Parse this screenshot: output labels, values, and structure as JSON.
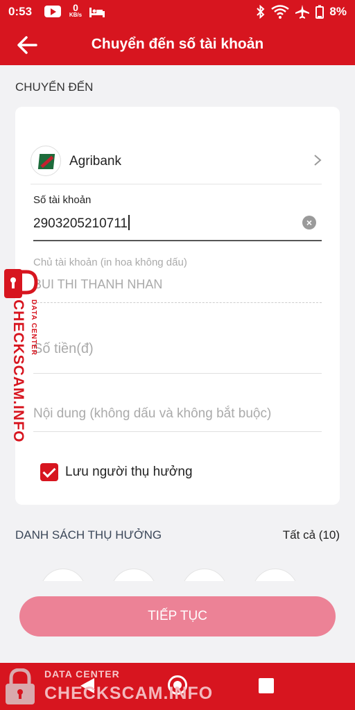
{
  "status_bar": {
    "time": "0:53",
    "net_speed": "0",
    "net_unit": "KB/s",
    "battery": "8%"
  },
  "app_bar": {
    "back_icon": "arrow-left-icon",
    "title": "Chuyển đến số tài khoản"
  },
  "transfer_section": {
    "title": "CHUYỂN ĐẾN"
  },
  "form": {
    "bank": {
      "name": "Agribank",
      "icon": "agribank-logo-icon"
    },
    "account_number": {
      "label": "Số tài khoản",
      "value": "2903205210711"
    },
    "account_owner": {
      "label": "Chủ tài khoản (in hoa không dấu)",
      "value": "BUI THI THANH NHAN"
    },
    "amount": {
      "placeholder": "Số tiền(đ)"
    },
    "note": {
      "placeholder": "Nội dung (không dấu và không bắt buộc)"
    },
    "save_beneficiary": {
      "label": "Lưu người thụ hưởng",
      "checked": true
    }
  },
  "beneficiaries": {
    "title": "DANH SÁCH THỤ HƯỞNG",
    "all_label": "Tất cả (10)"
  },
  "continue_button": {
    "label": "TIẾP TỤC"
  },
  "watermark": {
    "small": "DATA CENTER",
    "big": "CHECKSCAM.INFO"
  },
  "colors": {
    "brand_red": "#d7151f",
    "button_pink": "#ec8296"
  }
}
